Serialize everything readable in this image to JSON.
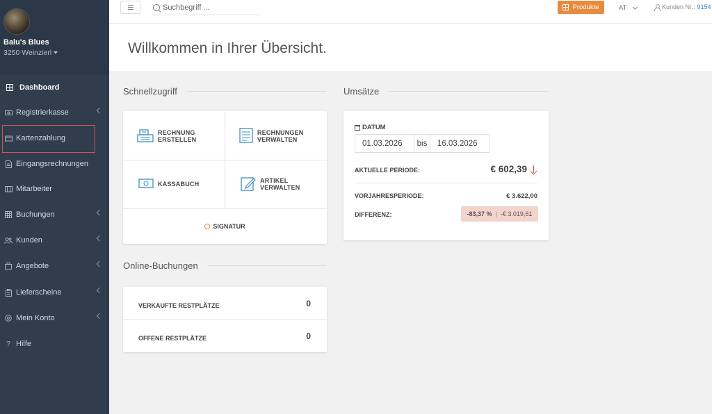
{
  "profile": {
    "name": "Balu's Blues",
    "location": "3250 Weinzierl"
  },
  "sidebar": {
    "items": [
      {
        "label": "Dashboard",
        "icon": "grid-icon",
        "active": true
      },
      {
        "label": "Registrierkasse",
        "icon": "cash-register-icon",
        "chevron": true
      },
      {
        "label": "Kartenzahlung",
        "icon": "credit-card-icon",
        "highlighted": true
      },
      {
        "label": "Eingangsrechnungen",
        "icon": "document-icon"
      },
      {
        "label": "Mitarbeiter",
        "icon": "employees-icon"
      },
      {
        "label": "Buchungen",
        "icon": "calendar-icon",
        "chevron": true
      },
      {
        "label": "Kunden",
        "icon": "customers-icon",
        "chevron": true
      },
      {
        "label": "Angebote",
        "icon": "briefcase-icon",
        "chevron": true
      },
      {
        "label": "Lieferscheine",
        "icon": "clipboard-icon",
        "chevron": true
      },
      {
        "label": "Mein Konto",
        "icon": "settings-icon",
        "chevron": true
      },
      {
        "label": "Hilfe",
        "icon": "help-icon"
      }
    ]
  },
  "topbar": {
    "search_placeholder": "Suchbegriff ...",
    "produkte_label": "Produkte",
    "language": "AT",
    "kunden_label": "Kunden Nr.:",
    "kunden_number": "9154"
  },
  "welcome": {
    "title": "Willkommen in Ihrer Übersicht."
  },
  "schnellzugriff": {
    "title": "Schnellzugriff",
    "rechnung_erstellen": [
      "RECHNUNG",
      "ERSTELLEN"
    ],
    "rechnungen_verwalten": [
      "RECHNUNGEN",
      "VERWALTEN"
    ],
    "kassabuch": "KASSABUCH",
    "artikel_verwalten": "ARTIKEL VERWALTEN",
    "signatur": "SIGNATUR"
  },
  "online_buchungen": {
    "title": "Online-Buchungen",
    "rows": [
      {
        "label": "VERKAUFTE RESTPLÄTZE",
        "value": "0"
      },
      {
        "label": "OFFENE RESTPLÄTZE",
        "value": "0"
      }
    ]
  },
  "umsaetze": {
    "title": "Umsätze",
    "datum_label": "DATUM",
    "date_from": "01.03.2026",
    "bis": "bis",
    "date_to": "16.03.2026",
    "aktuelle_label": "AKTUELLE PERIODE:",
    "aktuelle_value": "€ 602,39",
    "vorjahr_label": "VORJAHRESPERIODE:",
    "vorjahr_value": "€ 3.622,00",
    "differenz_label": "DIFFERENZ:",
    "differenz_percent": "-83,37 %",
    "differenz_sep": "|",
    "differenz_amount": "-€ 3.019,61"
  },
  "colors": {
    "sidebar_bg": "#2f3d4d",
    "accent_orange": "#e88b3d",
    "link_blue": "#3a7fc1",
    "negative_red": "#d9534f",
    "badge_bg": "#f2d4cd"
  }
}
